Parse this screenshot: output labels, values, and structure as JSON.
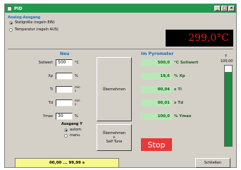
{
  "window": {
    "title": "PID",
    "buttons": [
      "_",
      "□",
      "×"
    ]
  },
  "output_group": {
    "title": "Analog-Ausgang",
    "options": [
      {
        "label": "Stellgröße (regeln EIN)",
        "selected": true
      },
      {
        "label": "Temperatur (regeln AUS)",
        "selected": false
      }
    ]
  },
  "display": {
    "temperature": "299,0°C"
  },
  "neu": {
    "heading": "Neu",
    "rows": [
      {
        "label": "Sollwert",
        "value": "500",
        "unit": "°C"
      },
      {
        "label": "Xp",
        "value": "",
        "unit": "%"
      },
      {
        "label": "Ti",
        "value": "",
        "unit_lines": [
          "min",
          "s"
        ]
      },
      {
        "label": "Td",
        "value": "",
        "unit_lines": [
          "min",
          "s"
        ]
      },
      {
        "label": "Ymax",
        "value": "30",
        "unit": "%"
      }
    ],
    "ausgang": {
      "title": "Ausgang Y",
      "options": [
        {
          "label": "autom.",
          "selected": true
        },
        {
          "label": "manu.",
          "selected": false
        }
      ]
    }
  },
  "buttons": {
    "uebernehmen": "Übernehmen",
    "uebernehmen_selftune": [
      "Übernehmen",
      "+",
      "Self Tune"
    ],
    "stop": "Stop",
    "schliessen": "Schließen"
  },
  "pyrometer": {
    "heading": "Im Pyrometer",
    "rows": [
      {
        "value": "500,0",
        "label": "°C Sollwert"
      },
      {
        "value": "18,6",
        "label": "% Xp"
      },
      {
        "value": "00,04",
        "label": "s Ti"
      },
      {
        "value": "00,01",
        "label": "s Td"
      },
      {
        "value": "100,0",
        "label": "% Ymax"
      }
    ]
  },
  "y_meter": {
    "label": "Y",
    "max_label": "100,00",
    "level_percent": 92,
    "fill_color": "#1f8a3f"
  },
  "status": {
    "text": "00,00 ... 99,99 s"
  }
}
